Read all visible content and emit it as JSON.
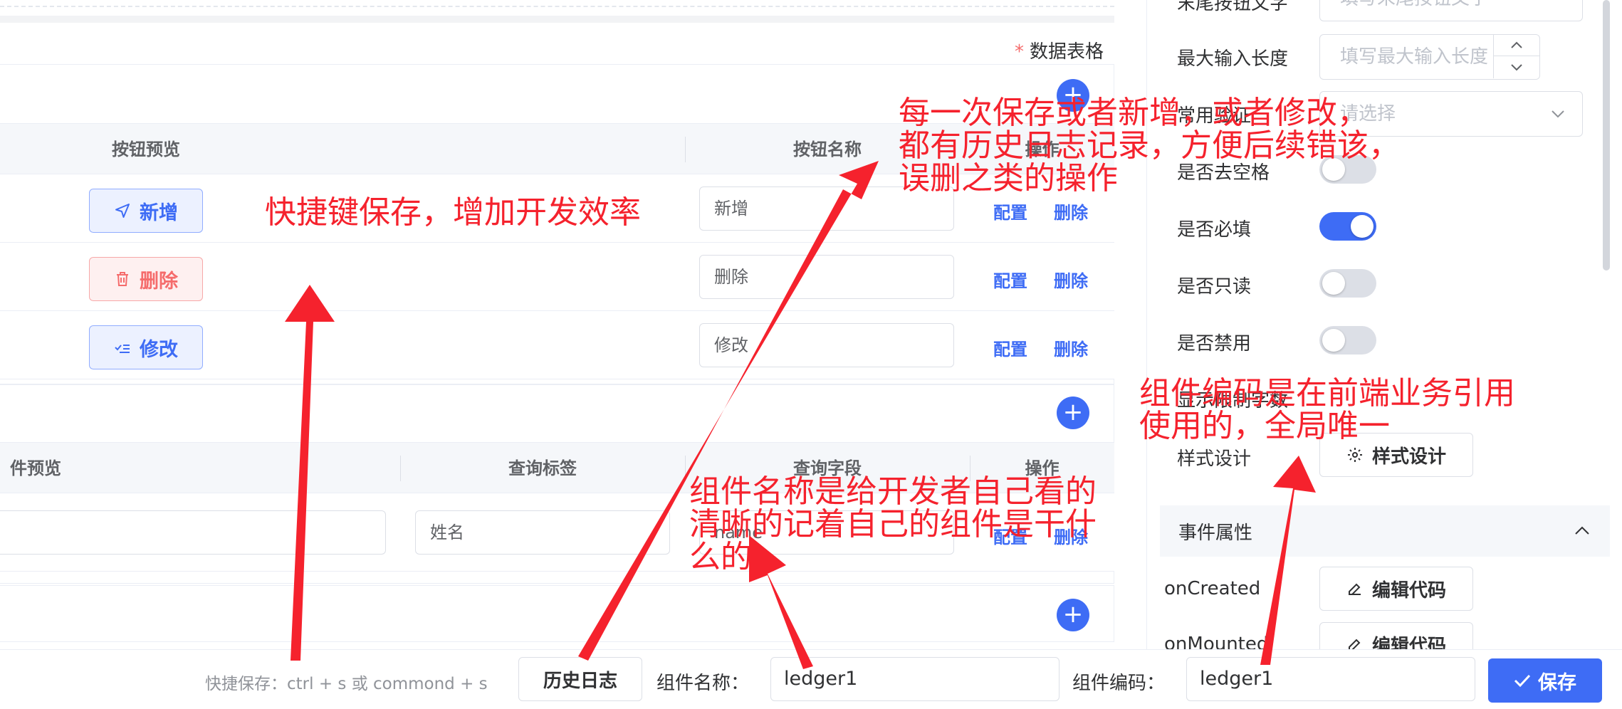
{
  "colors": {
    "primary": "#3e6cf5",
    "danger": "#f56c6c",
    "annotation": "#f5222d"
  },
  "button_section": {
    "field_label": "数据表格",
    "required_mark": "*",
    "add_icon": "plus-icon",
    "columns": [
      "按钮预览",
      "按钮名称",
      "操作"
    ],
    "rows": [
      {
        "preview_label": "新增",
        "preview_icon": "send-icon",
        "style": "blue",
        "name": "新增",
        "config": "配置",
        "delete": "删除"
      },
      {
        "preview_label": "删除",
        "preview_icon": "trash-icon",
        "style": "red",
        "name": "删除",
        "config": "配置",
        "delete": "删除"
      },
      {
        "preview_label": "修改",
        "preview_icon": "edit-list-icon",
        "style": "blue",
        "name": "修改",
        "config": "配置",
        "delete": "删除"
      }
    ]
  },
  "query_section": {
    "columns": [
      "件预览",
      "查询标签",
      "查询字段",
      "操作"
    ],
    "rows": [
      {
        "preview_value": "",
        "label": "姓名",
        "field": "name",
        "config": "配置",
        "delete": "删除"
      }
    ]
  },
  "right_panel": {
    "tail_button_text": {
      "label": "末尾按钮文字",
      "placeholder": "填写末尾按钮文字"
    },
    "max_length": {
      "label": "最大输入长度",
      "placeholder": "填写最大输入长度"
    },
    "common_validation": {
      "label": "常用验证",
      "placeholder": "请选择"
    },
    "trim": {
      "label": "是否去空格",
      "on": false
    },
    "required": {
      "label": "是否必填",
      "on": true
    },
    "readonly": {
      "label": "是否只读",
      "on": false
    },
    "disabled": {
      "label": "是否禁用",
      "on": false
    },
    "show_limit": {
      "label": "显示限制字数"
    },
    "style_design": {
      "label": "样式设计",
      "button": "样式设计"
    },
    "event_section": {
      "title": "事件属性"
    },
    "events": [
      {
        "name": "onCreated",
        "button": "编辑代码"
      },
      {
        "name": "onMounted",
        "button": "编辑代码"
      }
    ]
  },
  "footer": {
    "hint": "快捷保存：ctrl + s 或 commond + s",
    "history_button": "历史日志",
    "component_name_label": "组件名称：",
    "component_name_value": "ledger1",
    "component_code_label": "组件编码：",
    "component_code_value": "ledger1",
    "save_button": "保存"
  },
  "annotations": {
    "shortcut": "快捷键保存，增加开发效率",
    "history_lines": [
      "每一次保存或者新增，或者修改，",
      "都有历史日志记录，方便后续错该，",
      "误删之类的操作"
    ],
    "name_lines": [
      "组件名称是给开发者自己看的",
      "清晰的记着自己的组件是干什",
      "么的"
    ],
    "code_lines": [
      "组件编码是在前端业务引用",
      "使用的，全局唯一"
    ]
  }
}
